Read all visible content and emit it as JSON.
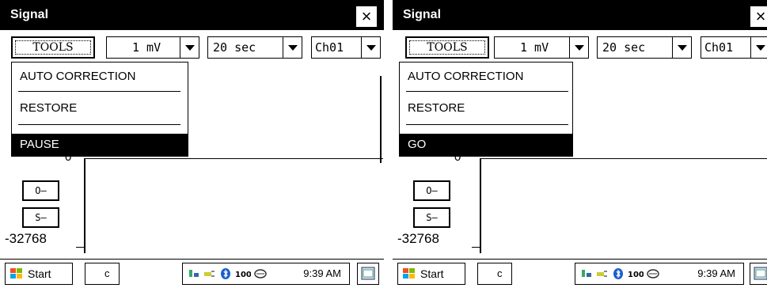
{
  "windows": [
    {
      "title": "Signal",
      "close_label": "×",
      "tools_label": "TOOLS",
      "scale_value": "1 mV",
      "time_value": "20 sec",
      "channel_value": "Ch01",
      "menu": {
        "item1": "AUTO  CORRECTION",
        "item2": "RESTORE",
        "item3": "PAUSE"
      },
      "zero_label": "0",
      "offset_minus": "O–",
      "scale_minus": "S–",
      "y_min": "-32768",
      "taskbar": {
        "start": "Start",
        "clock": "9:39 AM",
        "task_text": "c"
      }
    },
    {
      "title": "Signal",
      "close_label": "×",
      "tools_label": "TOOLS",
      "scale_value": "1 mV",
      "time_value": "20 sec",
      "channel_value": "Ch01",
      "menu": {
        "item1": "AUTO  CORRECTION",
        "item2": "RESTORE",
        "item3": "GO"
      },
      "zero_label": "0",
      "offset_minus": "O–",
      "scale_minus": "S–",
      "y_min": "-32768",
      "taskbar": {
        "start": "Start",
        "clock": "9:39 AM",
        "task_text": "c"
      }
    }
  ],
  "colors": {
    "titlebar": "#000000",
    "highlight": "#000000",
    "background": "#ffffff"
  },
  "icons": [
    "close-icon",
    "dropdown-arrow-icon",
    "windows-flag-icon",
    "network-icon",
    "power-icon",
    "bluetooth-icon",
    "battery-icon",
    "sync-icon",
    "desktop-icon"
  ]
}
